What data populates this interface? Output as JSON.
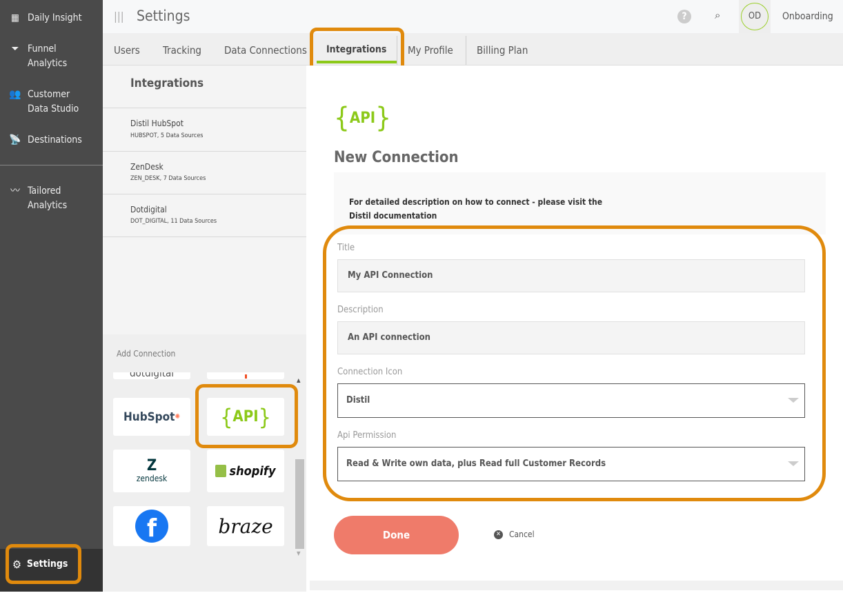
{
  "sidebar": {
    "items": [
      {
        "label": "Daily Insight",
        "icon": "grid-icon"
      },
      {
        "label": "Funnel Analytics",
        "icon": "funnel-icon"
      },
      {
        "label": "Customer Data Studio",
        "icon": "users-icon"
      },
      {
        "label": "Destinations",
        "icon": "broadcast-icon"
      },
      {
        "label": "Tailored Analytics",
        "icon": "trend-icon"
      }
    ],
    "settings_label": "Settings"
  },
  "header": {
    "title": "Settings",
    "avatar": "OD",
    "user": "Onboarding"
  },
  "tabs": [
    "Users",
    "Tracking",
    "Data Connections",
    "Integrations",
    "My Profile",
    "Billing Plan"
  ],
  "active_tab": "Integrations",
  "integrations": {
    "title": "Integrations",
    "items": [
      {
        "name": "Distil HubSpot",
        "detail": "HUBSPOT, 5 Data Sources"
      },
      {
        "name": "ZenDesk",
        "detail": "ZEN_DESK, 7 Data Sources"
      },
      {
        "name": "Dotdigital",
        "detail": "DOT_DIGITAL, 11 Data Sources"
      }
    ]
  },
  "add_connection": {
    "title": "Add Connection",
    "tiles": [
      "dotdigital",
      "HubSpot",
      "API",
      "zendesk",
      "shopify",
      "facebook",
      "braze"
    ]
  },
  "form": {
    "logo": "API",
    "heading": "New Connection",
    "info_line1": "For detailed description on how to connect - please visit the",
    "info_line2": "Distil documentation",
    "title_label": "Title",
    "title_value": "My API Connection",
    "description_label": "Description",
    "description_value": "An API connection",
    "icon_label": "Connection Icon",
    "icon_value": "Distil",
    "permission_label": "Api Permission",
    "permission_value": "Read & Write own data, plus Read full Customer Records",
    "done": "Done",
    "cancel": "Cancel"
  },
  "colors": {
    "accent": "#8cc919",
    "highlight": "#e08a0d",
    "done": "#ef7b6a",
    "sidebar": "#4a4a4a"
  }
}
